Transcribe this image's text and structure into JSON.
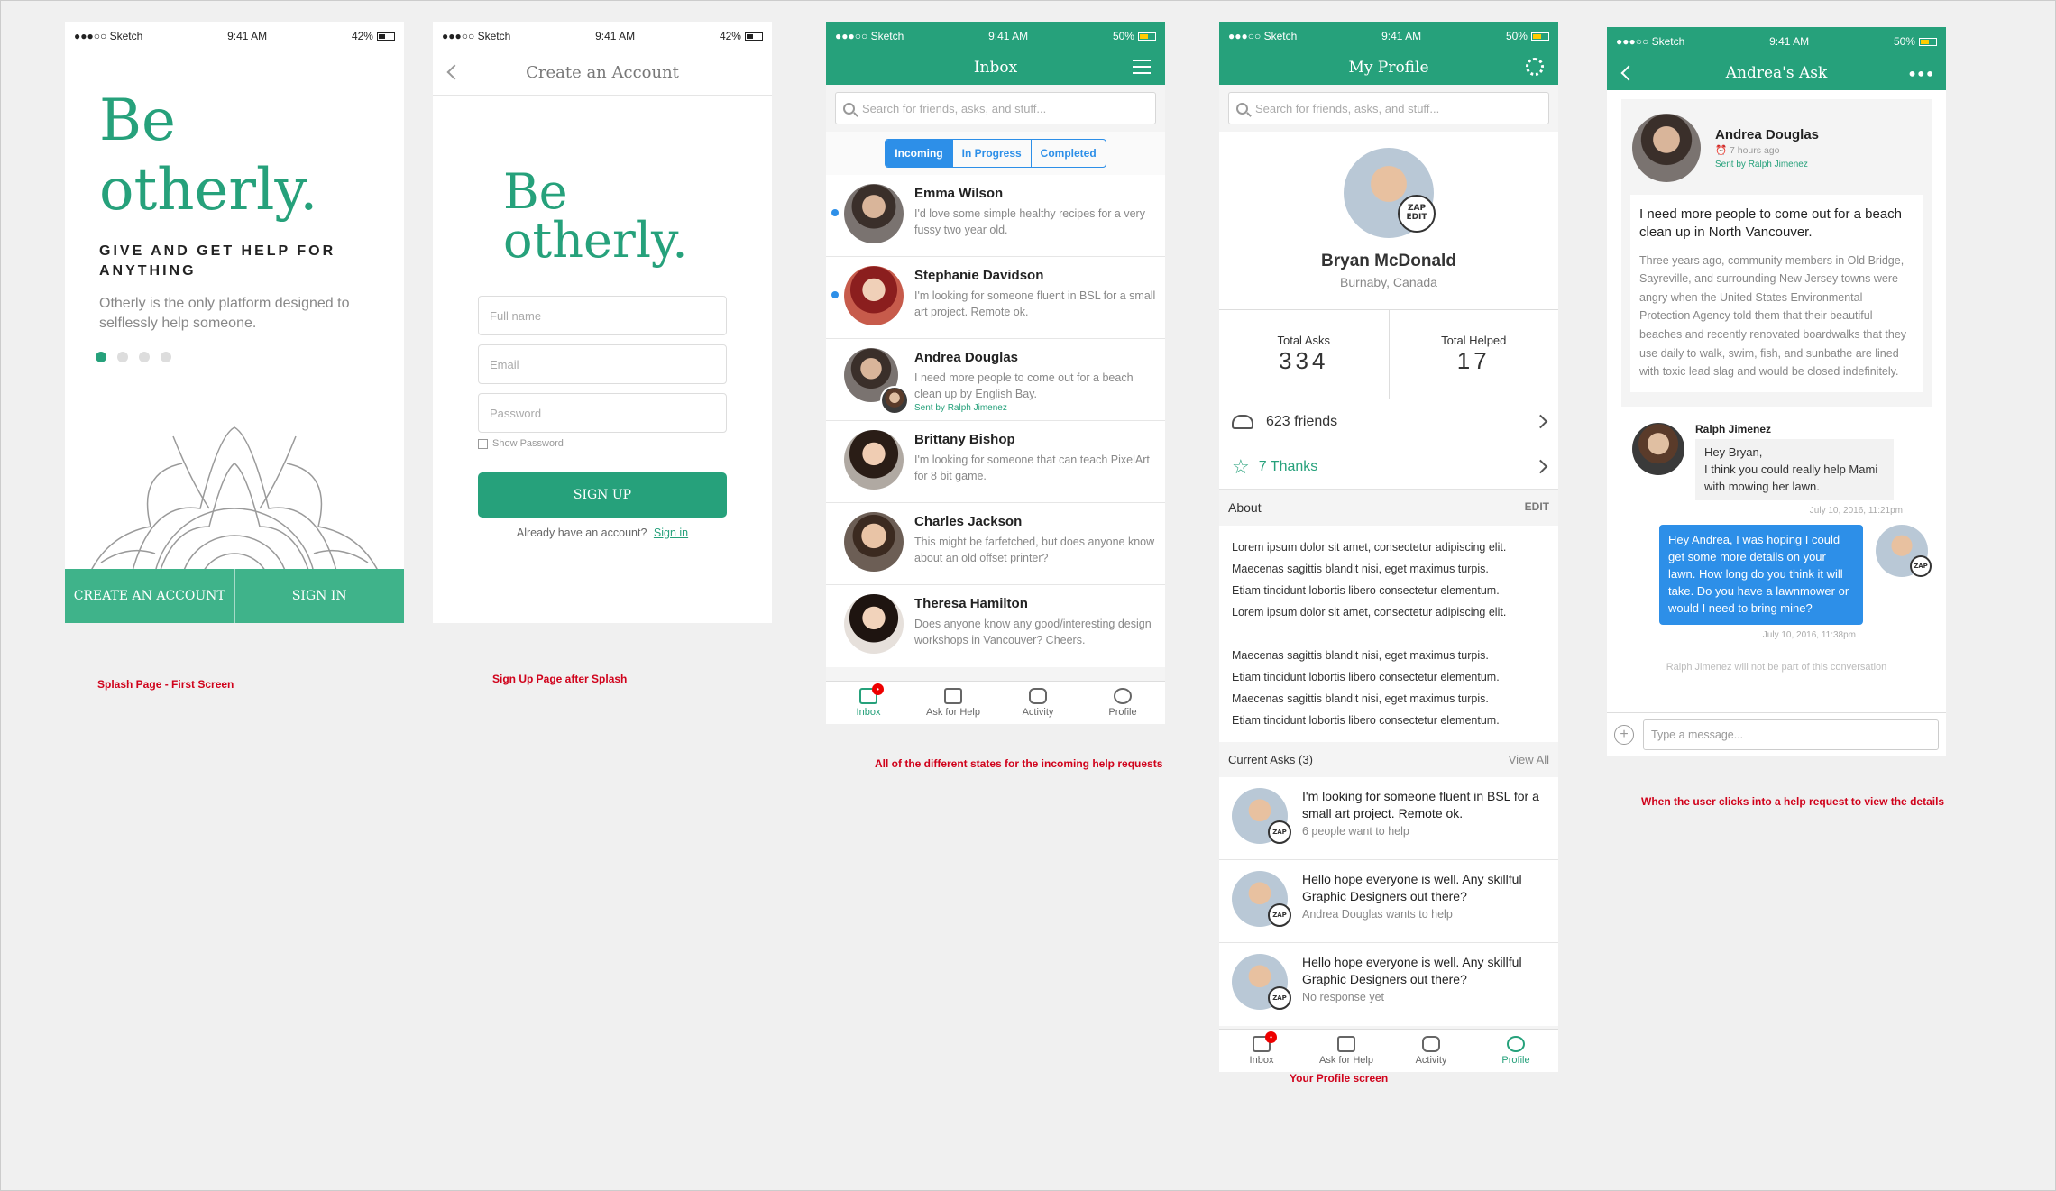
{
  "status": {
    "carrier": "●●●○○ Sketch",
    "time": "9:41 AM",
    "battery_42": "42%",
    "battery_50": "50%"
  },
  "splash": {
    "title_line1": "Be",
    "title_line2": "otherly.",
    "tagline": "GIVE AND GET HELP FOR ANYTHING",
    "description": "Otherly is the only platform designed to selflessly help someone.",
    "create_account": "CREATE AN ACCOUNT",
    "sign_in": "SIGN IN",
    "caption": "Splash Page - First Screen"
  },
  "signup": {
    "header": "Create an Account",
    "title_line1": "Be",
    "title_line2": "otherly.",
    "full_name_placeholder": "Full name",
    "email_placeholder": "Email",
    "password_placeholder": "Password",
    "show_password": "Show Password",
    "button": "SIGN UP",
    "already": "Already have an account?",
    "sign_in_link": "Sign in",
    "caption": "Sign Up Page after Splash"
  },
  "inbox": {
    "header": "Inbox",
    "search_placeholder": "Search for friends, asks, and stuff...",
    "segments": [
      "Incoming",
      "In Progress",
      "Completed"
    ],
    "messages": [
      {
        "name": "Emma Wilson",
        "text": "I'd love some simple healthy recipes for a very fussy two year old.",
        "sent": ""
      },
      {
        "name": "Stephanie Davidson",
        "text": "I'm looking for someone fluent in BSL for a small art project.  Remote ok.",
        "sent": ""
      },
      {
        "name": "Andrea Douglas",
        "text": "I need more people to come out for a beach clean up by English Bay.",
        "sent": "Sent by Ralph Jimenez"
      },
      {
        "name": "Brittany Bishop",
        "text": "I'm looking for someone that can teach PixelArt for 8 bit game.",
        "sent": ""
      },
      {
        "name": "Charles Jackson",
        "text": "This might be farfetched, but does anyone know about an old offset printer?",
        "sent": ""
      },
      {
        "name": "Theresa Hamilton",
        "text": "Does anyone know any good/interesting design workshops in Vancouver? Cheers.",
        "sent": ""
      }
    ],
    "tabs": [
      "Inbox",
      "Ask for Help",
      "Activity",
      "Profile"
    ],
    "badge": "•",
    "caption": "All of the different states for the incoming help requests"
  },
  "profile": {
    "header": "My Profile",
    "search_placeholder": "Search for friends, asks, and stuff...",
    "zap": "ZAP",
    "edit_badge": "EDIT",
    "name": "Bryan McDonald",
    "location": "Burnaby, Canada",
    "total_asks_label": "Total Asks",
    "total_asks": "334",
    "total_helped_label": "Total Helped",
    "total_helped": "17",
    "friends": "623 friends",
    "thanks": "7 Thanks",
    "about_label": "About",
    "edit": "EDIT",
    "about_p1": [
      "Lorem ipsum dolor sit amet, consectetur adipiscing elit.",
      "Maecenas sagittis blandit nisi, eget maximus turpis.",
      "Etiam tincidunt lobortis libero consectetur elementum.",
      "Lorem ipsum dolor sit amet, consectetur adipiscing elit."
    ],
    "about_p2": [
      "Maecenas sagittis blandit nisi, eget maximus turpis.",
      "Etiam tincidunt lobortis libero consectetur elementum.",
      "Maecenas sagittis blandit nisi, eget maximus turpis.",
      "Etiam tincidunt lobortis libero consectetur elementum."
    ],
    "current_asks_label": "Current Asks (3)",
    "view_all": "View All",
    "asks": [
      {
        "title": "I'm looking for someone fluent in BSL for a small art project.  Remote ok.",
        "meta": "6 people want to help"
      },
      {
        "title": "Hello hope everyone is well.  Any skillful Graphic Designers out there?",
        "meta": "Andrea Douglas wants to help"
      },
      {
        "title": "Hello hope everyone is well.  Any skillful Graphic Designers out there?",
        "meta": "No response yet"
      }
    ],
    "tabs": [
      "Inbox",
      "Ask for Help",
      "Activity",
      "Profile"
    ],
    "caption": "Your Profile screen"
  },
  "ask": {
    "header": "Andrea's Ask",
    "name": "Andrea Douglas",
    "time": "7 hours ago",
    "sent": "Sent by Ralph Jimenez",
    "title": "I need more people to come out for a beach clean up in North Vancouver.",
    "body": "Three years ago, community members in Old Bridge, Sayreville, and surrounding New Jersey towns were angry when the United States Environmental Protection Agency told them that their beautiful beaches and recently renovated boardwalks that they use daily to walk, swim, fish, and sunbathe are lined with toxic lead slag and would be closed indefinitely.",
    "ralph_name": "Ralph Jimenez",
    "ralph_msg": "Hey Bryan,\nI think you could really help Mami with mowing her lawn.",
    "ralph_time": "July 10, 2016, 11:21pm",
    "my_msg": "Hey Andrea, I was hoping I could get some more details on your lawn. How long do you think it will take. Do you have a lawnmower or would I need to bring mine?",
    "my_time": "July 10, 2016, 11:38pm",
    "notice": "Ralph Jimenez will not be part of this conversation",
    "input_placeholder": "Type a message...",
    "caption": "When the user clicks into a help request to view the details"
  }
}
